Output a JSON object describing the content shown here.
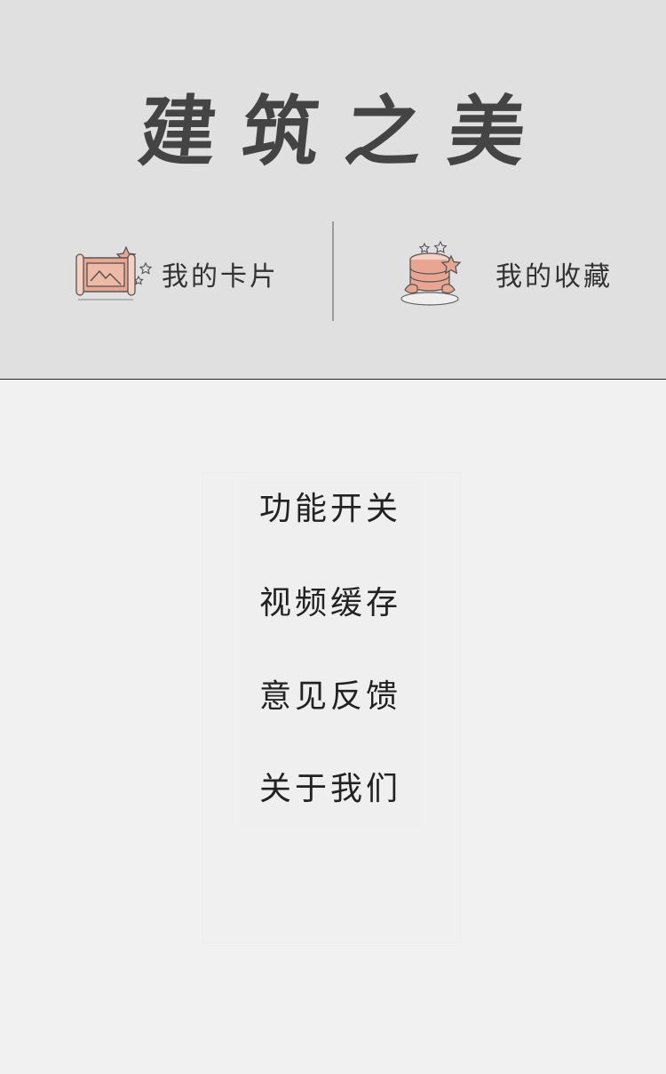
{
  "header": {
    "title": "建筑之美",
    "shortcuts": [
      {
        "label": "我的卡片",
        "icon": "picture-scroll-icon"
      },
      {
        "label": "我的收藏",
        "icon": "stacked-disks-star-icon"
      }
    ],
    "accent_color": "#e8a590"
  },
  "menu": {
    "items": [
      {
        "label": "功能开关"
      },
      {
        "label": "视频缓存"
      },
      {
        "label": "意见反馈"
      },
      {
        "label": "关于我们"
      }
    ]
  }
}
